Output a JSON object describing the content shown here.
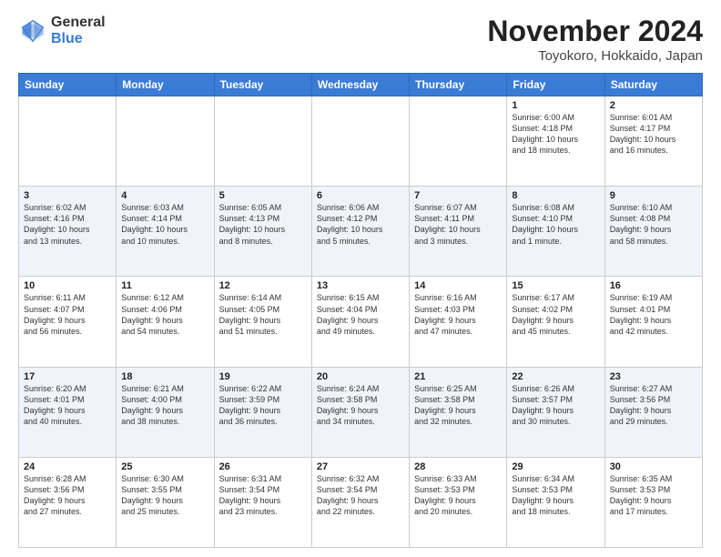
{
  "logo": {
    "line1": "General",
    "line2": "Blue"
  },
  "title": "November 2024",
  "subtitle": "Toyokoro, Hokkaido, Japan",
  "days_header": [
    "Sunday",
    "Monday",
    "Tuesday",
    "Wednesday",
    "Thursday",
    "Friday",
    "Saturday"
  ],
  "weeks": [
    {
      "alt": false,
      "days": [
        {
          "num": "",
          "info": ""
        },
        {
          "num": "",
          "info": ""
        },
        {
          "num": "",
          "info": ""
        },
        {
          "num": "",
          "info": ""
        },
        {
          "num": "",
          "info": ""
        },
        {
          "num": "1",
          "info": "Sunrise: 6:00 AM\nSunset: 4:18 PM\nDaylight: 10 hours\nand 18 minutes."
        },
        {
          "num": "2",
          "info": "Sunrise: 6:01 AM\nSunset: 4:17 PM\nDaylight: 10 hours\nand 16 minutes."
        }
      ]
    },
    {
      "alt": true,
      "days": [
        {
          "num": "3",
          "info": "Sunrise: 6:02 AM\nSunset: 4:16 PM\nDaylight: 10 hours\nand 13 minutes."
        },
        {
          "num": "4",
          "info": "Sunrise: 6:03 AM\nSunset: 4:14 PM\nDaylight: 10 hours\nand 10 minutes."
        },
        {
          "num": "5",
          "info": "Sunrise: 6:05 AM\nSunset: 4:13 PM\nDaylight: 10 hours\nand 8 minutes."
        },
        {
          "num": "6",
          "info": "Sunrise: 6:06 AM\nSunset: 4:12 PM\nDaylight: 10 hours\nand 5 minutes."
        },
        {
          "num": "7",
          "info": "Sunrise: 6:07 AM\nSunset: 4:11 PM\nDaylight: 10 hours\nand 3 minutes."
        },
        {
          "num": "8",
          "info": "Sunrise: 6:08 AM\nSunset: 4:10 PM\nDaylight: 10 hours\nand 1 minute."
        },
        {
          "num": "9",
          "info": "Sunrise: 6:10 AM\nSunset: 4:08 PM\nDaylight: 9 hours\nand 58 minutes."
        }
      ]
    },
    {
      "alt": false,
      "days": [
        {
          "num": "10",
          "info": "Sunrise: 6:11 AM\nSunset: 4:07 PM\nDaylight: 9 hours\nand 56 minutes."
        },
        {
          "num": "11",
          "info": "Sunrise: 6:12 AM\nSunset: 4:06 PM\nDaylight: 9 hours\nand 54 minutes."
        },
        {
          "num": "12",
          "info": "Sunrise: 6:14 AM\nSunset: 4:05 PM\nDaylight: 9 hours\nand 51 minutes."
        },
        {
          "num": "13",
          "info": "Sunrise: 6:15 AM\nSunset: 4:04 PM\nDaylight: 9 hours\nand 49 minutes."
        },
        {
          "num": "14",
          "info": "Sunrise: 6:16 AM\nSunset: 4:03 PM\nDaylight: 9 hours\nand 47 minutes."
        },
        {
          "num": "15",
          "info": "Sunrise: 6:17 AM\nSunset: 4:02 PM\nDaylight: 9 hours\nand 45 minutes."
        },
        {
          "num": "16",
          "info": "Sunrise: 6:19 AM\nSunset: 4:01 PM\nDaylight: 9 hours\nand 42 minutes."
        }
      ]
    },
    {
      "alt": true,
      "days": [
        {
          "num": "17",
          "info": "Sunrise: 6:20 AM\nSunset: 4:01 PM\nDaylight: 9 hours\nand 40 minutes."
        },
        {
          "num": "18",
          "info": "Sunrise: 6:21 AM\nSunset: 4:00 PM\nDaylight: 9 hours\nand 38 minutes."
        },
        {
          "num": "19",
          "info": "Sunrise: 6:22 AM\nSunset: 3:59 PM\nDaylight: 9 hours\nand 36 minutes."
        },
        {
          "num": "20",
          "info": "Sunrise: 6:24 AM\nSunset: 3:58 PM\nDaylight: 9 hours\nand 34 minutes."
        },
        {
          "num": "21",
          "info": "Sunrise: 6:25 AM\nSunset: 3:58 PM\nDaylight: 9 hours\nand 32 minutes."
        },
        {
          "num": "22",
          "info": "Sunrise: 6:26 AM\nSunset: 3:57 PM\nDaylight: 9 hours\nand 30 minutes."
        },
        {
          "num": "23",
          "info": "Sunrise: 6:27 AM\nSunset: 3:56 PM\nDaylight: 9 hours\nand 29 minutes."
        }
      ]
    },
    {
      "alt": false,
      "days": [
        {
          "num": "24",
          "info": "Sunrise: 6:28 AM\nSunset: 3:56 PM\nDaylight: 9 hours\nand 27 minutes."
        },
        {
          "num": "25",
          "info": "Sunrise: 6:30 AM\nSunset: 3:55 PM\nDaylight: 9 hours\nand 25 minutes."
        },
        {
          "num": "26",
          "info": "Sunrise: 6:31 AM\nSunset: 3:54 PM\nDaylight: 9 hours\nand 23 minutes."
        },
        {
          "num": "27",
          "info": "Sunrise: 6:32 AM\nSunset: 3:54 PM\nDaylight: 9 hours\nand 22 minutes."
        },
        {
          "num": "28",
          "info": "Sunrise: 6:33 AM\nSunset: 3:53 PM\nDaylight: 9 hours\nand 20 minutes."
        },
        {
          "num": "29",
          "info": "Sunrise: 6:34 AM\nSunset: 3:53 PM\nDaylight: 9 hours\nand 18 minutes."
        },
        {
          "num": "30",
          "info": "Sunrise: 6:35 AM\nSunset: 3:53 PM\nDaylight: 9 hours\nand 17 minutes."
        }
      ]
    }
  ]
}
